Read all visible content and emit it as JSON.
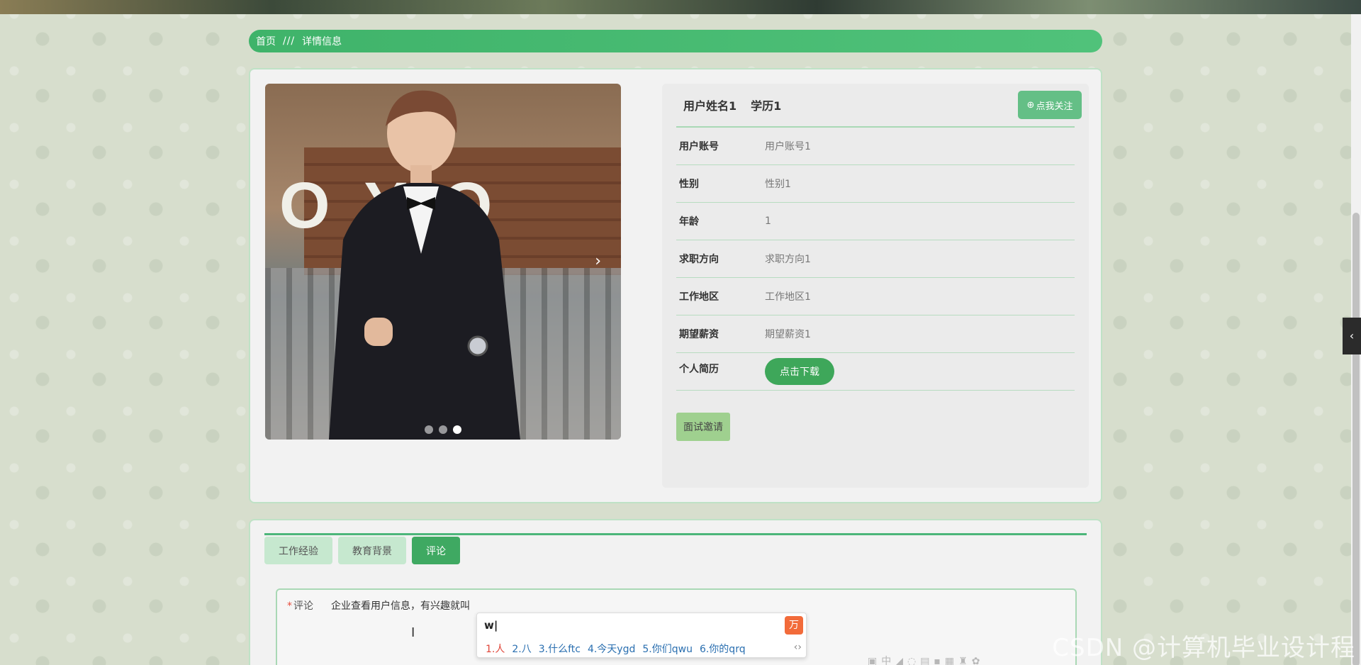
{
  "breadcrumb": {
    "home": "首页",
    "separator": "///",
    "current": "详情信息"
  },
  "profile": {
    "name": "用户姓名1",
    "education": "学历1",
    "follow_label": "点我关注",
    "follow_icon": "plus-circle-icon",
    "fields": [
      {
        "label": "用户账号",
        "value": "用户账号1"
      },
      {
        "label": "性别",
        "value": "性别1"
      },
      {
        "label": "年龄",
        "value": "1"
      },
      {
        "label": "求职方向",
        "value": "求职方向1"
      },
      {
        "label": "工作地区",
        "value": "工作地区1"
      },
      {
        "label": "期望薪资",
        "value": "期望薪资1"
      }
    ],
    "resume_label": "个人简历",
    "download_label": "点击下载",
    "invite_label": "面试邀请"
  },
  "carousel": {
    "slide_count": 3,
    "active_slide": 3,
    "photo_text": "OYO"
  },
  "tabs": [
    {
      "label": "工作经验",
      "active": false
    },
    {
      "label": "教育背景",
      "active": false
    },
    {
      "label": "评论",
      "active": true
    }
  ],
  "comment": {
    "required_mark": "*",
    "label": "评论",
    "value": "企业查看用户信息，有兴趣就叫"
  },
  "ime": {
    "input": "w|",
    "logo": "万",
    "candidates": [
      "1.人",
      "2.八",
      "3.什么ftc",
      "4.今天ygd",
      "5.你们qwu",
      "6.你的qrq"
    ],
    "nav": "‹›"
  },
  "watermark": "CSDN @计算机毕业设计程",
  "colors": {
    "accent": "#3fa962",
    "breadcrumb": "#4cb67a",
    "follow": "#64bf86",
    "invite": "#9fd08f"
  }
}
